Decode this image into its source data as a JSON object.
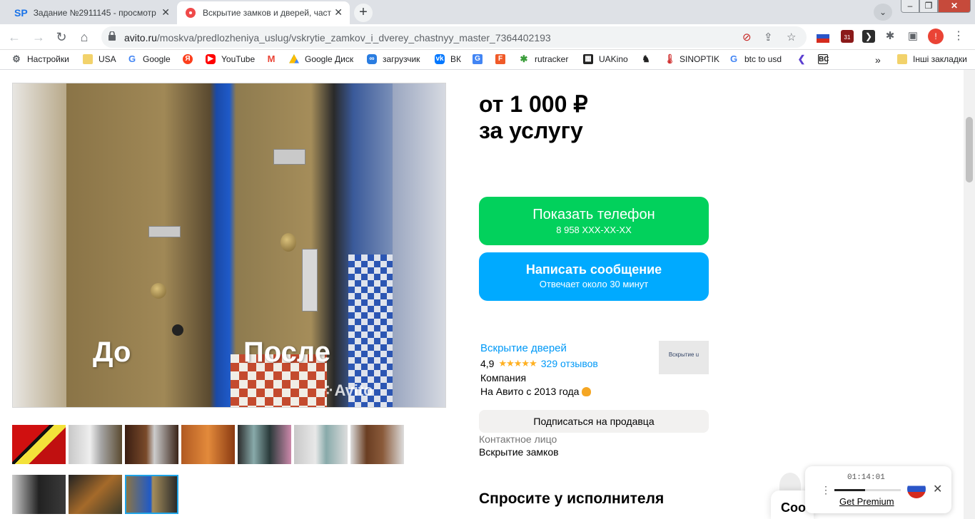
{
  "browser": {
    "tabs": [
      {
        "favicon": "SP",
        "title": "Задание №2911145 - просмотр",
        "active": false
      },
      {
        "favicon": "avito",
        "title": "Вскрытие замков и дверей, част",
        "active": true
      }
    ],
    "new_tab": "+",
    "url_host": "avito.ru",
    "url_path": "/moskva/predlozheniya_uslug/vskrytie_zamkov_i_dverey_chastnyy_master_7364402193",
    "bookmarks": [
      {
        "label": "Настройки",
        "icon": "gear-icon"
      },
      {
        "label": "USA",
        "icon": "folder-icon"
      },
      {
        "label": "Google",
        "icon": "google-icon"
      },
      {
        "label": "",
        "icon": "yandex-icon"
      },
      {
        "label": "YouTube",
        "icon": "youtube-icon"
      },
      {
        "label": "",
        "icon": "gmail-icon"
      },
      {
        "label": "Google Диск",
        "icon": "drive-icon"
      },
      {
        "label": "загрузчик",
        "icon": "loader-icon"
      },
      {
        "label": "ВК",
        "icon": "vk-icon"
      },
      {
        "label": "",
        "icon": "translate-icon"
      },
      {
        "label": "",
        "icon": "f-icon"
      },
      {
        "label": "rutracker",
        "icon": "rutracker-icon"
      },
      {
        "label": "UAKino",
        "icon": "uakino-icon"
      },
      {
        "label": "",
        "icon": "chess-icon"
      },
      {
        "label": "SINOPTIK",
        "icon": "thermometer-icon"
      },
      {
        "label": "btc to usd",
        "icon": "google-icon"
      },
      {
        "label": "",
        "icon": "arrow-icon"
      },
      {
        "label": "",
        "icon": "bc-icon"
      }
    ],
    "more_bookmarks": "»",
    "other_bookmarks": "Інші закладки",
    "ext_badge": "31"
  },
  "listing": {
    "price_line1": "от 1 000 ₽",
    "price_line2": "за услугу",
    "phone_button": "Показать телефон",
    "phone_number": "8 958 XXX-XX-XX",
    "message_button": "Написать сообщение",
    "message_sub": "Отвечает около 30 минут",
    "photo_before": "До",
    "photo_after": "После",
    "photo_watermark": "Avito",
    "seller_name": "Вскрытие дверей",
    "seller_rating": "4,9",
    "seller_stars": "★★★★★",
    "seller_stars_value": 4.9,
    "seller_reviews": "329 отзывов",
    "seller_type": "Компания",
    "seller_since": "На Авито с 2013 года",
    "seller_logo_text": "Вскрытие u",
    "subscribe_button": "Подписаться на продавца",
    "contact_label": "Контактное лицо",
    "contact_value": "Вскрытие замков",
    "ask_heading": "Спросите у исполнителя",
    "chat_fragment": "Соо"
  },
  "player": {
    "time": "01:14:01",
    "progress": 0.46,
    "link": "Get Premium"
  },
  "colors": {
    "green": "#02d15c",
    "blue": "#00aaff",
    "link": "#0099f7",
    "star": "#ffb021"
  }
}
